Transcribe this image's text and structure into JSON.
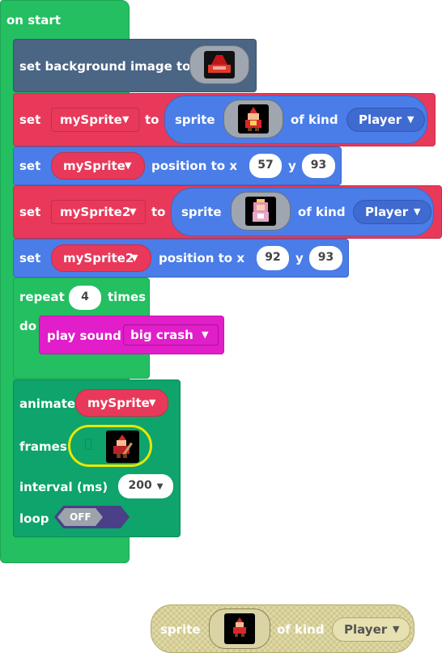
{
  "hat": {
    "label": "on start"
  },
  "bg_block": {
    "label": "set background image to",
    "image_icon": "red-pixel-stage-icon"
  },
  "set_sprite1": {
    "set_label": "set",
    "var": "mySprite",
    "to_label": "to",
    "sprite_label": "sprite",
    "of_kind_label": "of kind",
    "kind": "Player",
    "image_icon": "red-wizard-sprite-icon"
  },
  "pos1": {
    "set_label": "set",
    "var": "mySprite",
    "position_label": "position to x",
    "x": "57",
    "y_label": "y",
    "y": "93"
  },
  "set_sprite2": {
    "set_label": "set",
    "var": "mySprite2",
    "to_label": "to",
    "sprite_label": "sprite",
    "of_kind_label": "of kind",
    "kind": "Player",
    "image_icon": "pink-princess-sprite-icon"
  },
  "pos2": {
    "set_label": "set",
    "var": "mySprite2",
    "position_label": "position to x",
    "x": "92",
    "y_label": "y",
    "y": "93"
  },
  "repeat": {
    "label": "repeat",
    "count": "4",
    "times_label": "times",
    "do_label": "do"
  },
  "sound": {
    "label": "play sound",
    "sound": "big crash"
  },
  "animate": {
    "label": "animate",
    "var": "mySprite",
    "frames_label": "frames",
    "frame_icon": "wizard-frame-icon",
    "interval_label": "interval (ms)",
    "interval": "200",
    "loop_label": "loop",
    "loop_value": "OFF"
  },
  "ghost": {
    "sprite_label": "sprite",
    "of_kind_label": "of kind",
    "kind": "Player",
    "image_icon": "red-wizard-sprite-icon"
  },
  "colors": {
    "events": "#23bf61",
    "scene": "#4b6584",
    "sprites": "#e8395a",
    "position": "#4a7de8",
    "loops": "#23bf61",
    "music": "#e11ec9",
    "animation": "#0ea46b",
    "highlight": "#e8e800"
  }
}
